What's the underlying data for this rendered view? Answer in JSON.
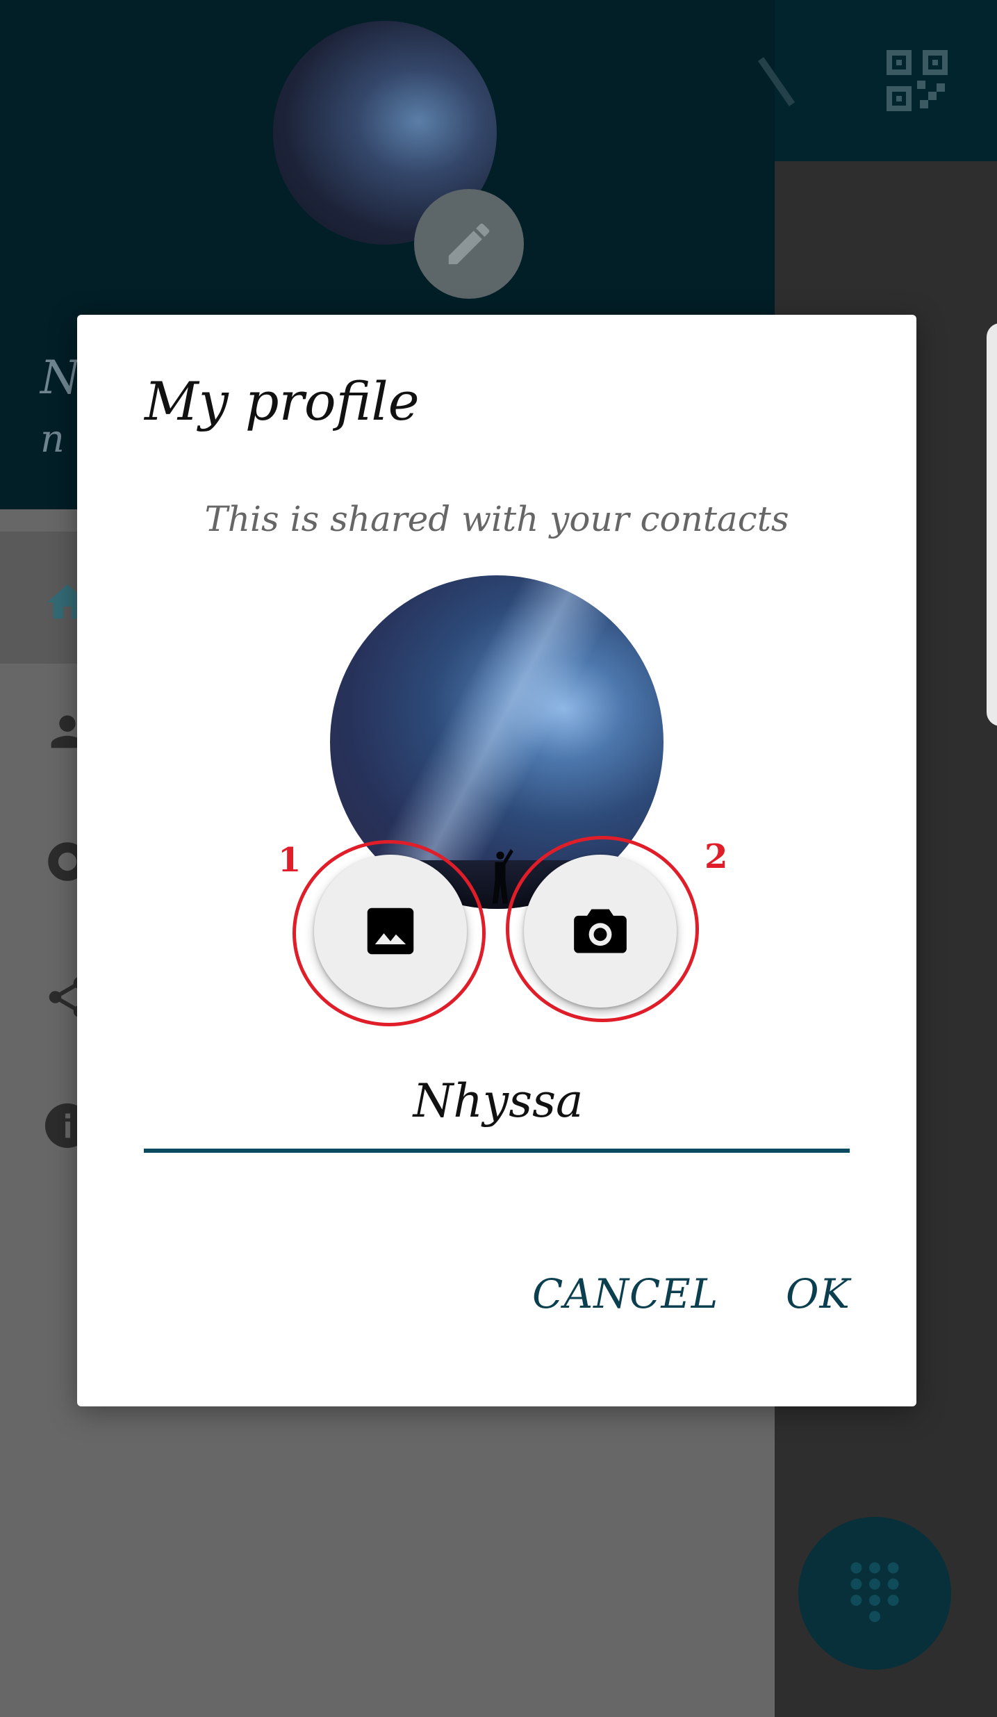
{
  "background": {
    "profile_name": "N",
    "profile_email": "n"
  },
  "dialog": {
    "title": "My profile",
    "subtitle": "This is shared with your contacts",
    "name_value": "Nhyssa",
    "cancel_label": "CANCEL",
    "ok_label": "OK"
  },
  "annotations": {
    "gallery_number": "1",
    "camera_number": "2"
  },
  "colors": {
    "accent": "#0b4a5e",
    "annotation": "#e01e2a",
    "header_bg": "#021e26"
  }
}
